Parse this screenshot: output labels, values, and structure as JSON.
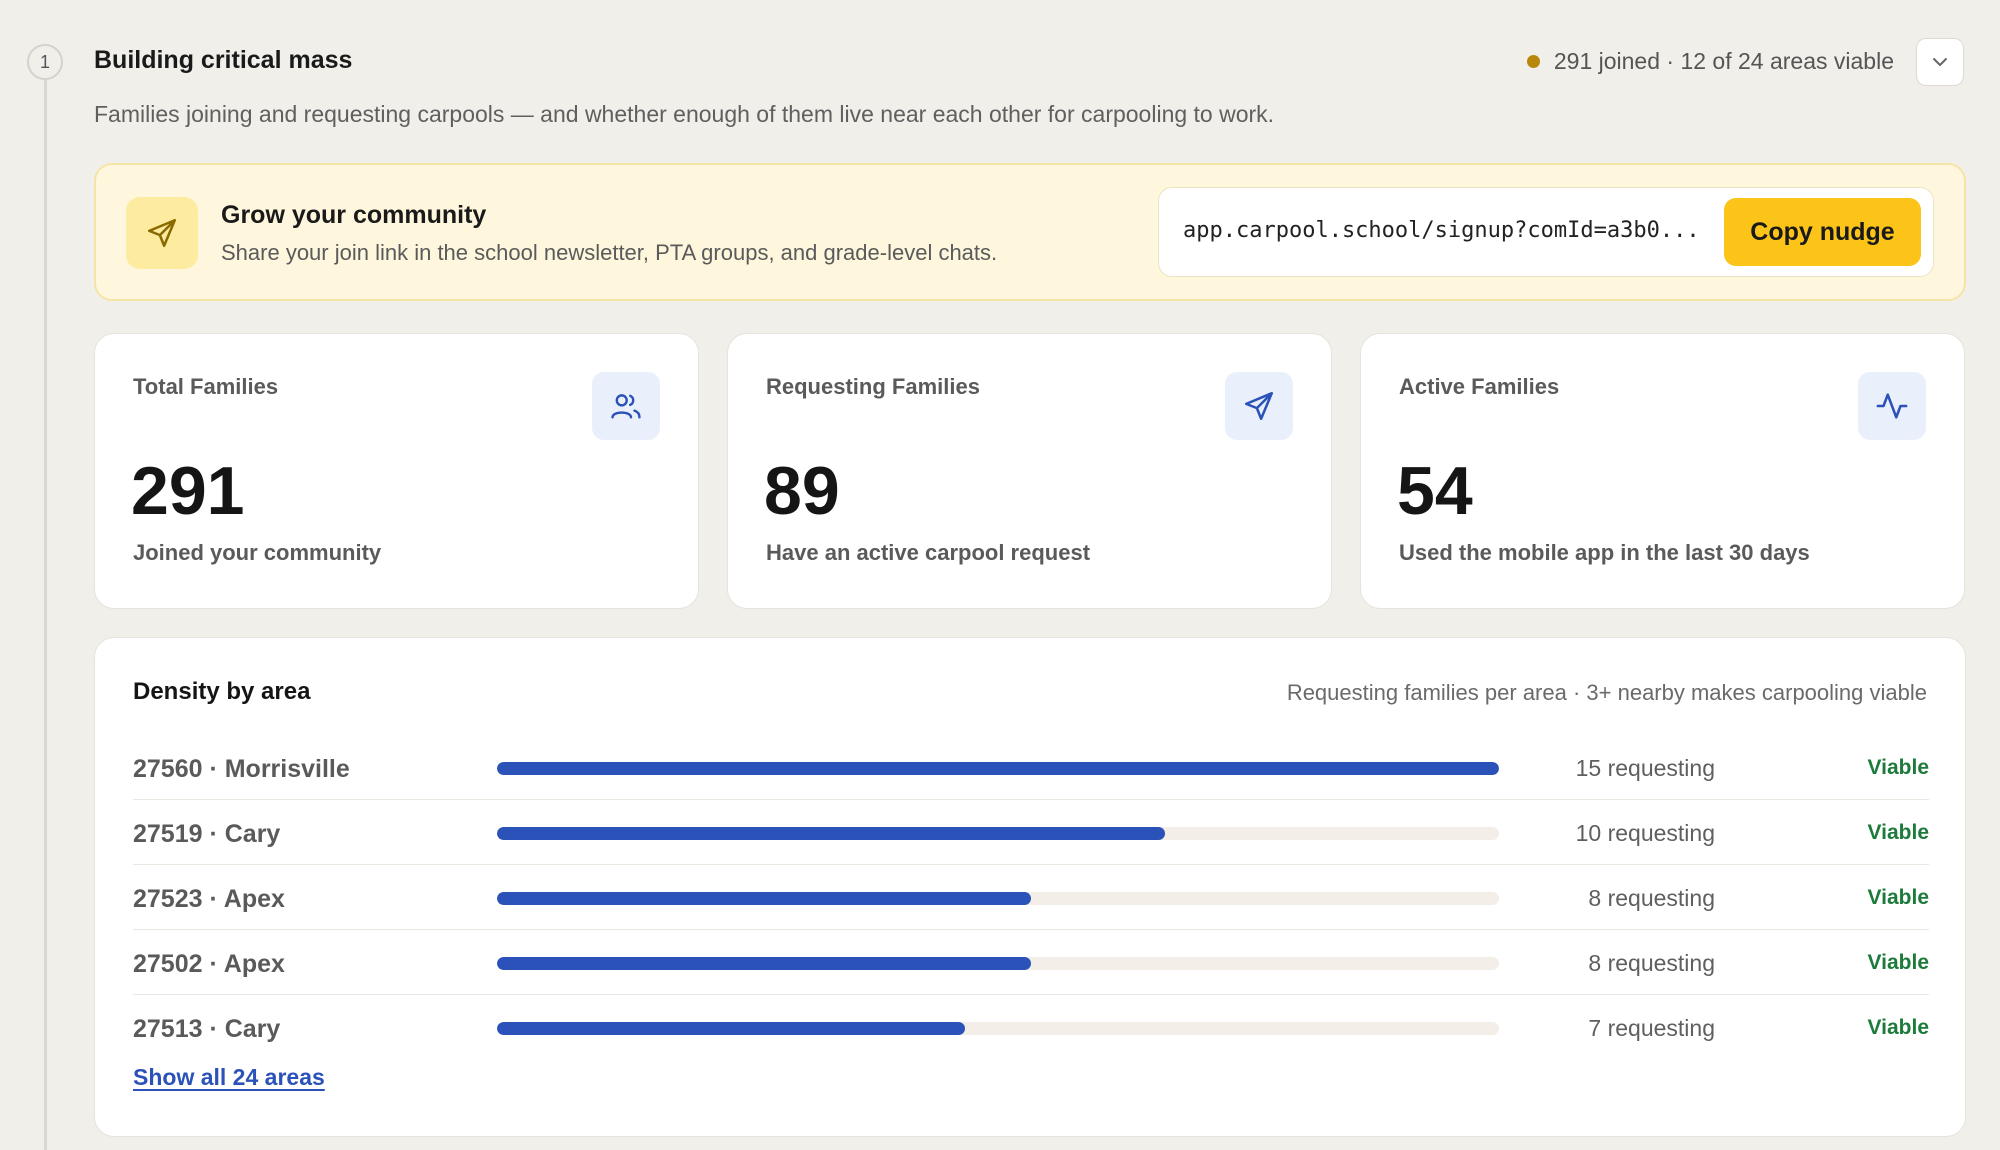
{
  "section": {
    "step": "1",
    "title": "Building critical mass",
    "status": "291 joined · 12 of 24 areas viable",
    "status_color": "#b8860b",
    "description": "Families joining and requesting carpools — and whether enough of them live near each other for carpooling to work."
  },
  "nudge": {
    "icon": "send-icon",
    "title": "Grow your community",
    "subtitle": "Share your join link in the school newsletter, PTA groups, and grade-level chats.",
    "link": "app.carpool.school/signup?comId=a3b0...",
    "copy_label": "Copy nudge",
    "accent": "#fcc419"
  },
  "stats": [
    {
      "label": "Total Families",
      "value": "291",
      "caption": "Joined your community",
      "icon": "users-icon"
    },
    {
      "label": "Requesting Families",
      "value": "89",
      "caption": "Have an active carpool request",
      "icon": "send-icon"
    },
    {
      "label": "Active Families",
      "value": "54",
      "caption": "Used the mobile app in the last 30 days",
      "icon": "activity-icon"
    }
  ],
  "density": {
    "title": "Density by area",
    "note": "Requesting families per area · 3+ nearby makes carpooling viable",
    "max": 15,
    "bar_color": "#2b52b8",
    "areas": [
      {
        "name": "27560 · Morrisville",
        "count": 15,
        "requesting": "15 requesting",
        "status": "Viable"
      },
      {
        "name": "27519 · Cary",
        "count": 10,
        "requesting": "10 requesting",
        "status": "Viable"
      },
      {
        "name": "27523 · Apex",
        "count": 8,
        "requesting": "8 requesting",
        "status": "Viable"
      },
      {
        "name": "27502 · Apex",
        "count": 8,
        "requesting": "8 requesting",
        "status": "Viable"
      },
      {
        "name": "27513 · Cary",
        "count": 7,
        "requesting": "7 requesting",
        "status": "Viable"
      }
    ],
    "show_all": "Show all 24 areas"
  }
}
